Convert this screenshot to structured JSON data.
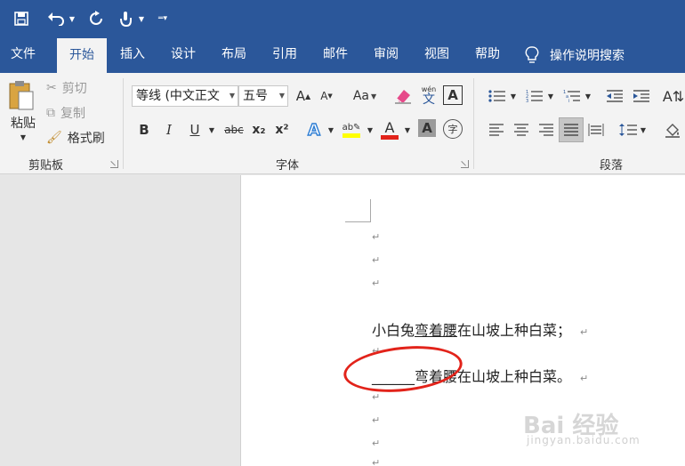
{
  "ribbon_tabs": [
    "文件",
    "开始",
    "插入",
    "设计",
    "布局",
    "引用",
    "邮件",
    "审阅",
    "视图",
    "帮助"
  ],
  "search_label": "操作说明搜索",
  "clipboard": {
    "paste": "粘贴",
    "cut": "剪切",
    "copy": "复制",
    "format_painter": "格式刷",
    "group_label": "剪贴板"
  },
  "font": {
    "name": "等线 (中文正文",
    "size": "五号",
    "group_label": "字体",
    "bold": "B",
    "italic": "I",
    "underline": "U",
    "strikethrough": "abc",
    "subscript": "x₂",
    "superscript": "x²",
    "change_case": "Aa",
    "grow": "A",
    "shrink": "A",
    "phonetic": "wén",
    "phonetic_char": "文",
    "enclose_char": "字",
    "highlight_color": "#ffff00",
    "font_color": "#e2231a"
  },
  "paragraph": {
    "group_label": "段落"
  },
  "document": {
    "line1": "小白兔",
    "line1_underlined": "弯着腰",
    "line1_rest": "在山坡上种白菜；",
    "line2_blank": "______",
    "line2_rest": "弯着腰在山坡上种白菜。",
    "para_mark": "↵"
  },
  "watermark": {
    "text": "Bai 经验",
    "url": "jingyan.baidu.com"
  }
}
